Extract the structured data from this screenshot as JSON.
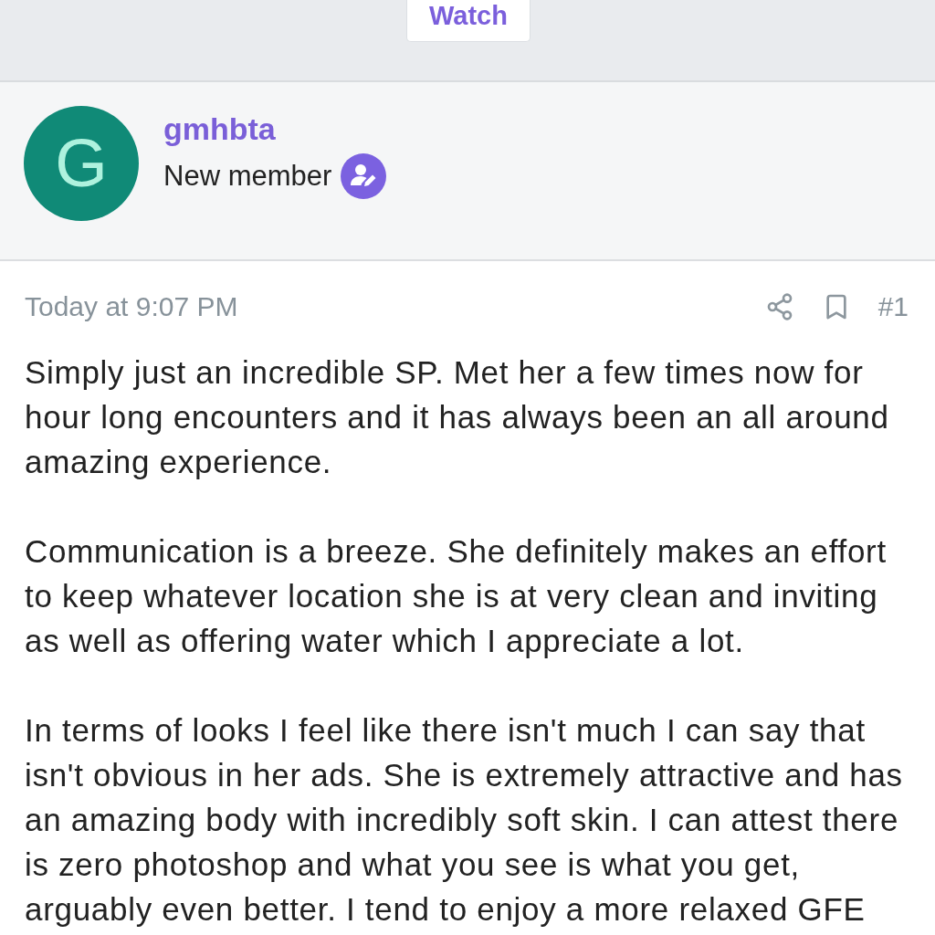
{
  "header": {
    "watch_button": "Watch"
  },
  "author": {
    "avatar_letter": "G",
    "username": "gmhbta",
    "title": "New member"
  },
  "post": {
    "time": "Today at 9:07 PM",
    "number": "#1",
    "paragraphs": [
      "Simply just an incredible SP. Met her a few times now for hour long encounters and it has always been an all around amazing experience.",
      "Communication is a breeze. She definitely makes an effort to keep whatever location she is at very clean and inviting as well as offering water which I appreciate a lot.",
      "In terms of looks I feel like there isn't much I can say that isn't obvious in her ads. She is extremely attractive and has an amazing body with incredibly soft skin. I can attest there is zero photoshop and what you see is what you get, arguably even better. I tend to enjoy a more relaxed GFE"
    ]
  }
}
